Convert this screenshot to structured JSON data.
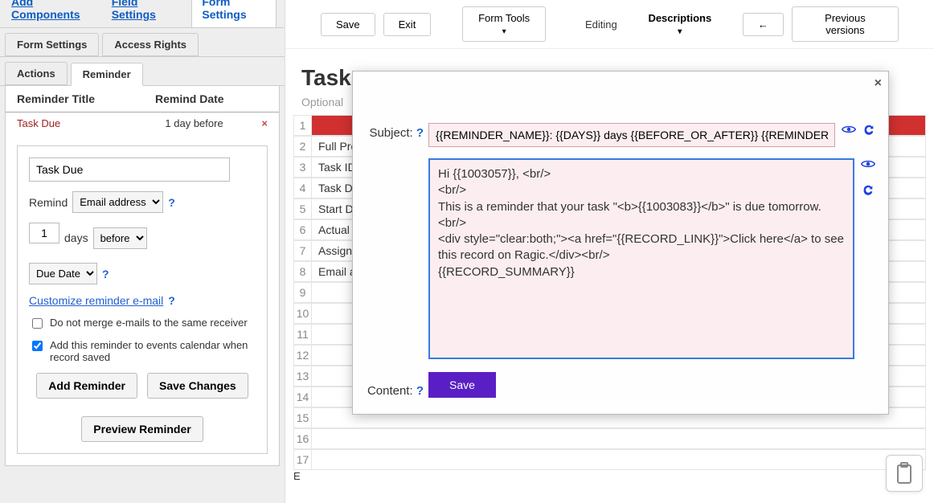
{
  "top_tabs": {
    "add": "Add Components",
    "field": "Field Settings",
    "form": "Form Settings"
  },
  "sub_tabs": {
    "form_settings": "Form Settings",
    "access": "Access Rights",
    "actions": "Actions",
    "reminder": "Reminder"
  },
  "reminder_table": {
    "h1": "Reminder Title",
    "h2": "Remind Date",
    "row_title": "Task Due",
    "row_date": "1 day before",
    "del": "×"
  },
  "form": {
    "title_value": "Task Due",
    "remind_label": "Remind",
    "remind_select": "Email address",
    "days_num": "1",
    "days_label": "days",
    "before_select": "before",
    "date_field": "Due Date",
    "customize": "Customize reminder e-mail",
    "chk1": "Do not merge e-mails to the same receiver",
    "chk2": "Add this reminder to events calendar when record saved",
    "add_btn": "Add Reminder",
    "save_btn": "Save Changes",
    "preview": "Preview Reminder"
  },
  "toolbar": {
    "save": "Save",
    "exit": "Exit",
    "tools": "Form Tools",
    "editing": "Editing",
    "desc": "Descriptions",
    "back": "←",
    "prev": "Previous versions"
  },
  "sheet": {
    "title": "Tasks",
    "optional": "Optional",
    "rows": [
      "",
      "Full Project",
      "Task ID",
      "Task Description",
      "Start Date",
      "Actual End",
      "Assigned",
      "Email address",
      "",
      "",
      "",
      "",
      "",
      "",
      "",
      "",
      ""
    ],
    "E": "E"
  },
  "modal": {
    "subject_label": "Subject:",
    "subject_value": "{{REMINDER_NAME}}: {{DAYS}} days {{BEFORE_OR_AFTER}} {{REMINDER_DATE}} -",
    "content_label": "Content:",
    "content_value": "Hi {{1003057}}, <br/>\n<br/>\nThis is a reminder that your task \"<b>{{1003083}}</b>\" is due tomorrow.<br/>\n<div style=\"clear:both;\"><a href=\"{{RECORD_LINK}}\">Click here</a> to see this record on Ragic.</div><br/>\n{{RECORD_SUMMARY}}",
    "save": "Save",
    "close": "×",
    "help": "?"
  }
}
